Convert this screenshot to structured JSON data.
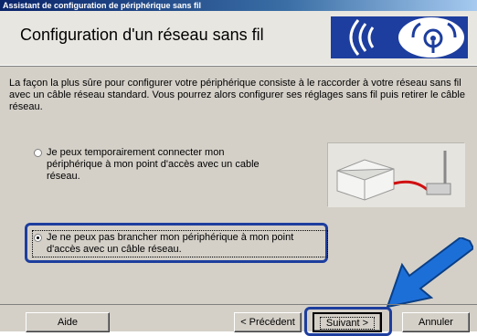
{
  "window": {
    "title": "Assistant de configuration de périphérique sans fil"
  },
  "header": {
    "title": "Configuration d'un réseau sans fil",
    "logo_icon": "wireless-signal-icon"
  },
  "intro": {
    "text": "La façon la plus sûre pour configurer votre périphérique consiste à le raccorder à votre réseau sans fil avec un câble réseau standard. Vous pourrez alors configurer ses réglages sans fil puis retirer le câble réseau."
  },
  "options": [
    {
      "label": "Je peux temporairement connecter mon périphérique à mon point d'accès avec un cable réseau.",
      "selected": false
    },
    {
      "label": "Je ne peux pas brancher mon périphérique à mon point d'accès avec un câble réseau.",
      "selected": true
    }
  ],
  "illustration": {
    "icon": "printer-cable-access-point-icon"
  },
  "buttons": {
    "help": "Aide",
    "back": "< Précédent",
    "next": "Suivant >",
    "cancel": "Annuler"
  },
  "colors": {
    "highlight": "#1d3e9e",
    "dialog_bg": "#d4d0c8",
    "titlebar": "#0a246a"
  }
}
